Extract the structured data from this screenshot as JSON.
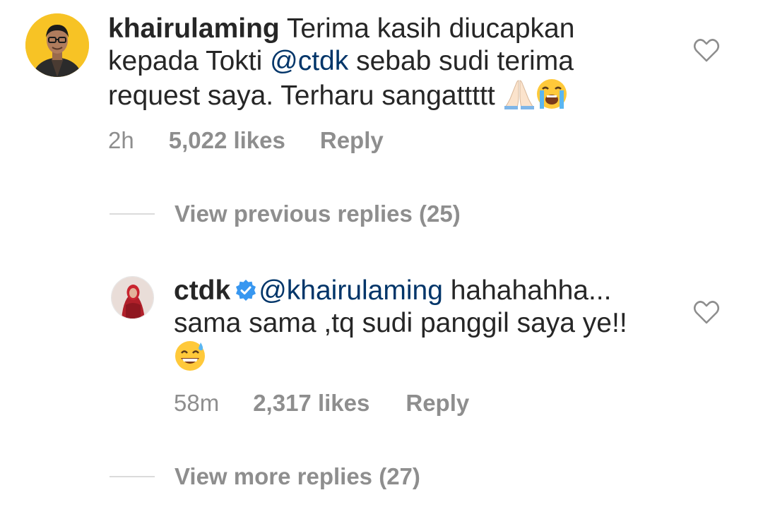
{
  "comment": {
    "username": "khairulaming",
    "text_before_mention": " Terima kasih diucapkan kepada Tokti ",
    "mention": "@ctdk",
    "text_after_mention": "  sebab sudi terima request saya. Terharu sangattttt ",
    "emojis": [
      "folded-hands-emoji",
      "loudly-crying-emoji"
    ],
    "time": "2h",
    "likes": "5,022 likes",
    "reply_label": "Reply"
  },
  "view_previous": "View previous replies (25)",
  "reply": {
    "username": "ctdk",
    "verified": true,
    "mention": "@khairulaming",
    "text": " hahahahha... sama sama ,tq sudi panggil saya ye!!",
    "emojis": [
      "grinning-sweat-emoji"
    ],
    "time": "58m",
    "likes": "2,317 likes",
    "reply_label": "Reply"
  },
  "view_more": "View more replies (27)",
  "colors": {
    "text": "#262626",
    "mention": "#003569",
    "secondary": "#8e8e8e",
    "divider": "#dbdbdb",
    "verified": "#3897f0"
  }
}
